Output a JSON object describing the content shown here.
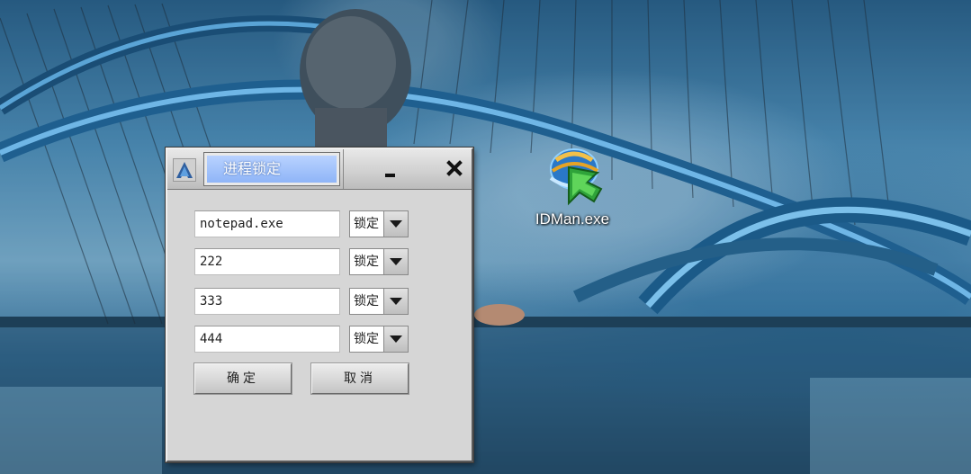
{
  "dialog": {
    "title": "进程锁定",
    "rows": [
      {
        "value": "notepad.exe",
        "select": "锁定"
      },
      {
        "value": "222",
        "select": "锁定"
      },
      {
        "value": "333",
        "select": "锁定"
      },
      {
        "value": "444",
        "select": "锁定"
      }
    ],
    "ok_label": "确定",
    "cancel_label": "取消"
  },
  "desktop": {
    "icon_label": "IDMan.exe",
    "icon": "idm-globe-arrow-icon"
  },
  "colors": {
    "title_highlight": "#8fb5f7",
    "dialog_bg": "#d6d6d6"
  }
}
